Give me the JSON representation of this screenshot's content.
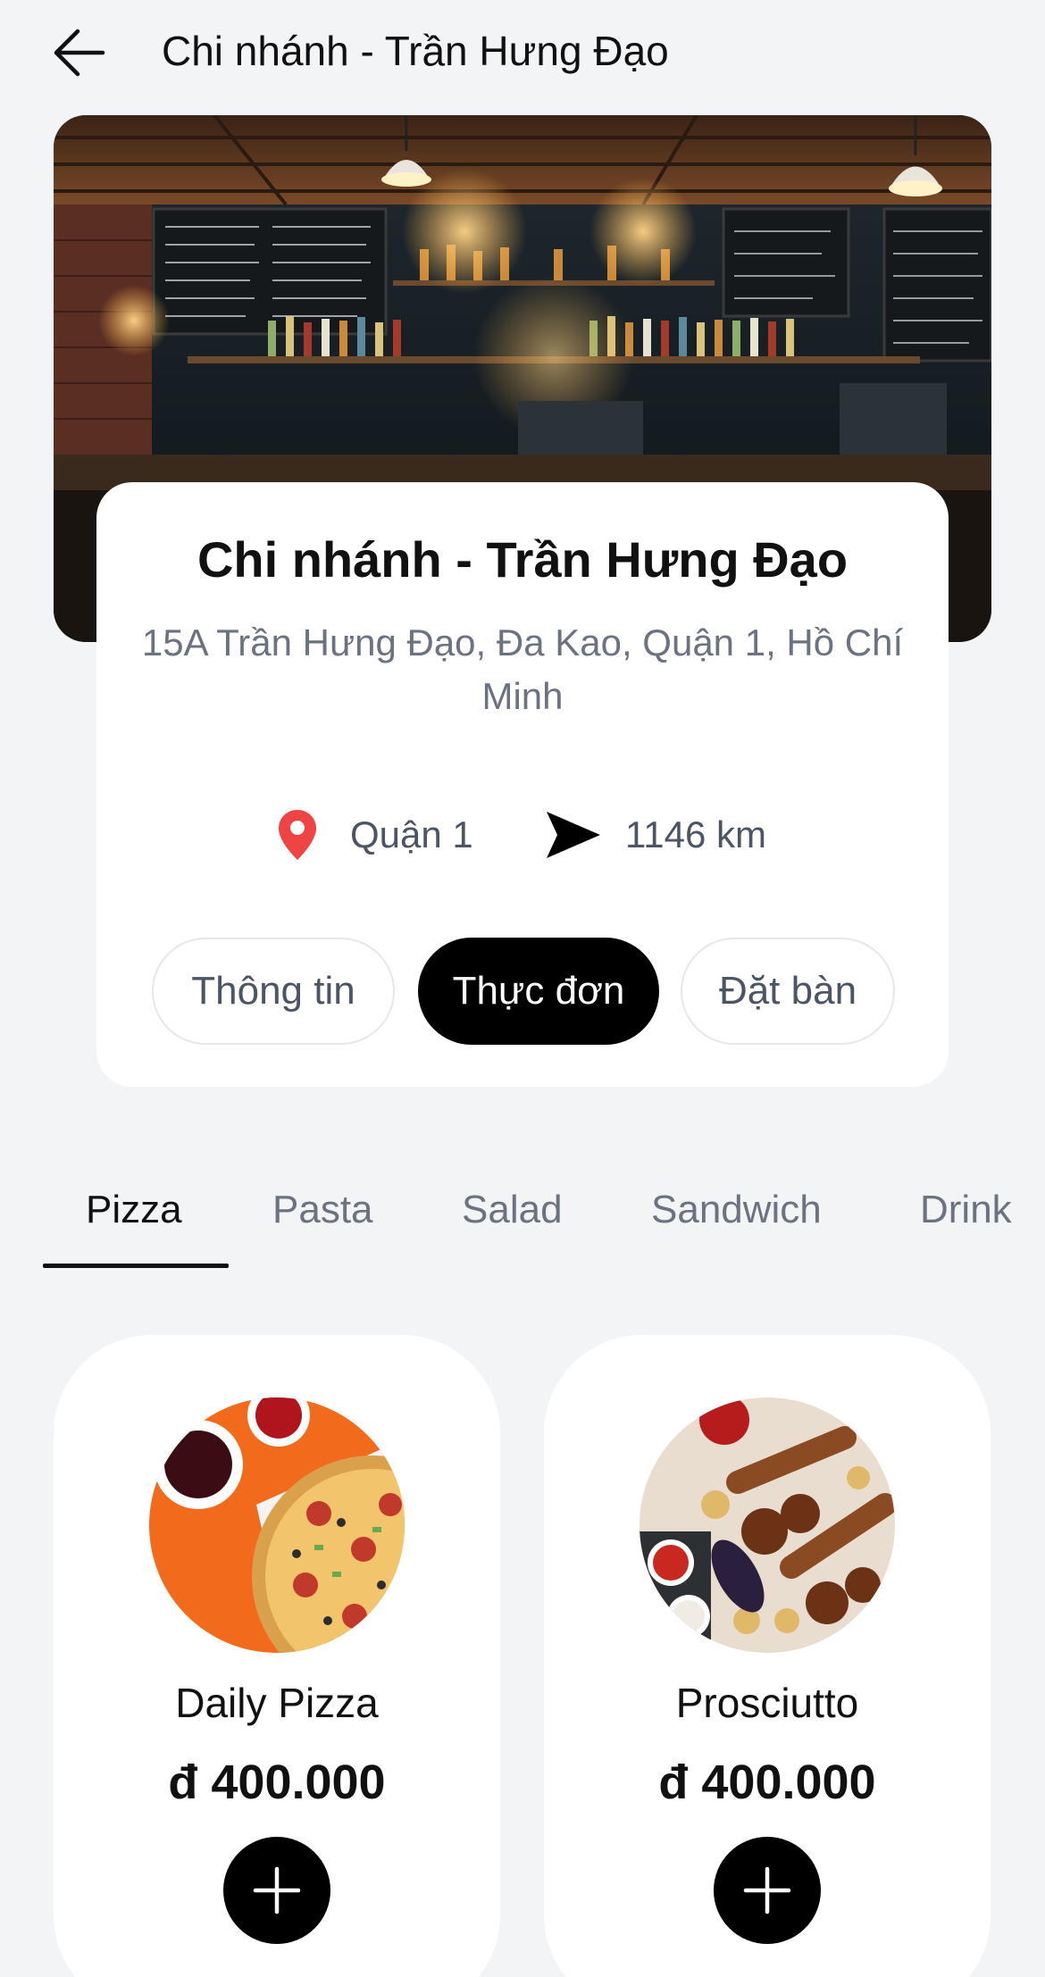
{
  "header": {
    "title": "Chi nhánh - Trần Hưng Đạo",
    "back_icon": "arrow-left-icon"
  },
  "hero": {
    "image": "restaurant-bar-interior-photo"
  },
  "branch": {
    "name": "Chi nhánh - Trần Hưng Đạo",
    "address": "15A Trần Hưng Đạo, Đa Kao, Quận 1, Hồ Chí Minh",
    "district": "Quận 1",
    "district_icon": "location-pin-icon",
    "district_icon_color": "#ef4444",
    "distance": "1146 km",
    "distance_icon": "navigation-arrow-icon"
  },
  "segment_tabs": [
    {
      "label": "Thông tin",
      "active": false
    },
    {
      "label": "Thực đơn",
      "active": true
    },
    {
      "label": "Đặt bàn",
      "active": false
    }
  ],
  "categories": [
    {
      "label": "Pizza",
      "active": true
    },
    {
      "label": "Pasta",
      "active": false
    },
    {
      "label": "Salad",
      "active": false
    },
    {
      "label": "Sandwich",
      "active": false
    },
    {
      "label": "Drink",
      "active": false
    }
  ],
  "products": [
    {
      "name": "Daily Pizza",
      "price": "đ 400.000",
      "image": "pizza-photo"
    },
    {
      "name": "Prosciutto",
      "price": "đ 400.000",
      "image": "grilled-meat-photo"
    }
  ],
  "colors": {
    "background": "#f3f4f6",
    "card": "#ffffff",
    "accent": "#000000",
    "muted_text": "#6b7280",
    "pin": "#ef4444"
  }
}
